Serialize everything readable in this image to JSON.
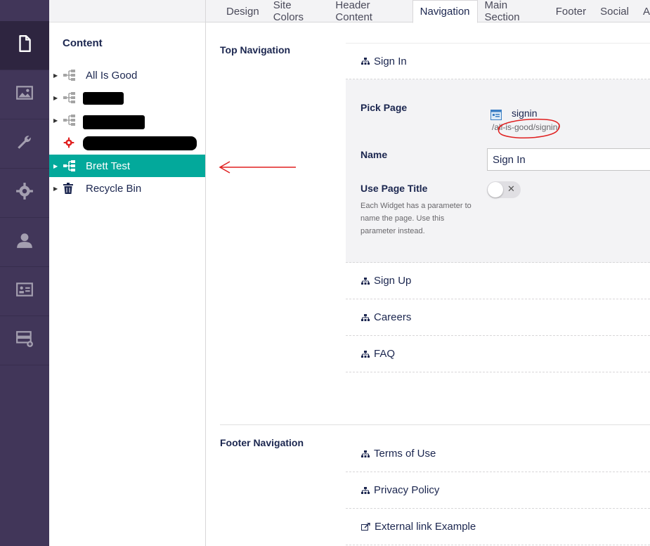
{
  "leftbar": {
    "items": [
      {
        "icon": "document-icon",
        "active": true
      },
      {
        "icon": "image-icon"
      },
      {
        "icon": "wrench-icon"
      },
      {
        "icon": "gear-icon"
      },
      {
        "icon": "user-icon"
      },
      {
        "icon": "id-card-icon"
      },
      {
        "icon": "form-add-icon"
      }
    ]
  },
  "tree": {
    "title": "Content",
    "nodes": [
      {
        "label": "All Is Good",
        "icon": "sitemap-icon"
      },
      {
        "label": "",
        "icon": "sitemap-icon",
        "redacted": true
      },
      {
        "label": "",
        "icon": "sitemap-icon",
        "redacted": true
      },
      {
        "label": "",
        "icon": "red-gear-icon",
        "redacted": true
      },
      {
        "label": "Brett Test",
        "icon": "sitemap-icon",
        "selected": true
      },
      {
        "label": "Recycle Bin",
        "icon": "trash-icon"
      }
    ]
  },
  "tabs": [
    "Design",
    "Site Colors",
    "Header Content",
    "Navigation",
    "Main Section",
    "Footer",
    "Social",
    "A"
  ],
  "active_tab": "Navigation",
  "top_nav": {
    "label": "Top Navigation",
    "items": [
      "Sign In",
      "Sign Up",
      "Careers",
      "FAQ"
    ],
    "editor": {
      "pick_page_label": "Pick Page",
      "picked_page_name": "signin",
      "picked_page_url": "/all-is-good/signin/",
      "name_label": "Name",
      "name_value": "Sign In",
      "use_page_title_label": "Use Page Title",
      "use_page_title_desc": "Each Widget has a parameter to name the page. Use this parameter instead.",
      "use_page_title_on": false
    }
  },
  "footer_nav": {
    "label": "Footer Navigation",
    "items": [
      "Terms of Use",
      "Privacy Policy",
      "External link Example"
    ]
  },
  "colors": {
    "sidebar": "#413659",
    "selected": "#03a99b",
    "annotation": "#e02020"
  }
}
